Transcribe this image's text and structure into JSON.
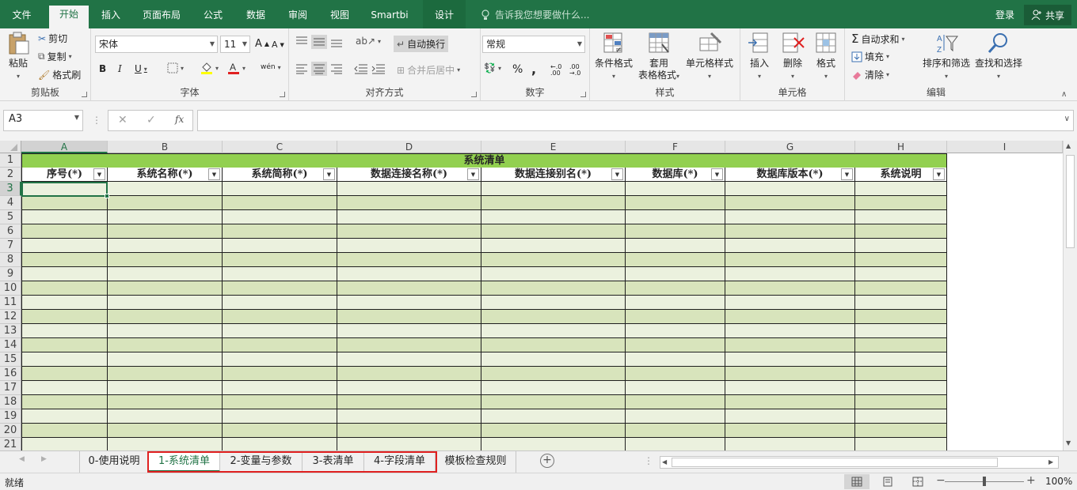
{
  "ribbon_tabs": [
    "文件",
    "开始",
    "插入",
    "页面布局",
    "公式",
    "数据",
    "审阅",
    "视图",
    "Smartbi",
    "设计"
  ],
  "tell_me": "告诉我您想要做什么...",
  "login": "登录",
  "share": "共享",
  "clipboard": {
    "paste": "粘贴",
    "cut": "剪切",
    "copy": "复制",
    "format_painter": "格式刷",
    "label": "剪贴板"
  },
  "font": {
    "name": "宋体",
    "size": "11",
    "label": "字体",
    "bold": "B",
    "italic": "I",
    "underline": "U",
    "grow": "A",
    "shrink": "A",
    "phonetic": "wén"
  },
  "alignment": {
    "wrap": "自动换行",
    "merge": "合并后居中",
    "label": "对齐方式"
  },
  "number": {
    "format": "常规",
    "percent": "%",
    "comma": ",",
    "label": "数字",
    "inc": "←.0 .00",
    "dec": ".00 →.0"
  },
  "styles": {
    "conditional": "条件格式",
    "table": "套用",
    "table2": "表格格式",
    "cell": "单元格样式",
    "label": "样式"
  },
  "cells": {
    "insert": "插入",
    "delete": "删除",
    "format": "格式",
    "label": "单元格"
  },
  "editing": {
    "autosum": "自动求和",
    "fill": "填充",
    "clear": "清除",
    "sort": "排序和筛选",
    "find": "查找和选择",
    "label": "编辑"
  },
  "name_box": "A3",
  "fx": "fx",
  "columns": [
    "A",
    "B",
    "C",
    "D",
    "E",
    "F",
    "G",
    "H",
    "I"
  ],
  "rows": [
    "1",
    "2",
    "3",
    "4",
    "5",
    "6",
    "7",
    "8",
    "9",
    "10",
    "11",
    "12",
    "13",
    "14",
    "15",
    "16",
    "17",
    "18",
    "19",
    "20",
    "21"
  ],
  "sheet": {
    "title": "系统清单",
    "headers": [
      "序号(*)",
      "系统名称(*)",
      "系统简称(*)",
      "数据连接名称(*)",
      "数据连接别名(*)",
      "数据库(*)",
      "数据库版本(*)",
      "系统说明"
    ]
  },
  "sheet_tabs": [
    "0-使用说明",
    "1-系统清单",
    "2-变量与参数",
    "3-表清单",
    "4-字段清单",
    "模板检查规则"
  ],
  "active_sheet_tab": "1-系统清单",
  "status": {
    "ready": "就绪",
    "zoom": "100%"
  },
  "colors": {
    "accent": "#217346",
    "header_fill": "#92d050",
    "band_dark": "#d8e4bc",
    "band_light": "#ebf1de",
    "highlight": "#e02020"
  }
}
